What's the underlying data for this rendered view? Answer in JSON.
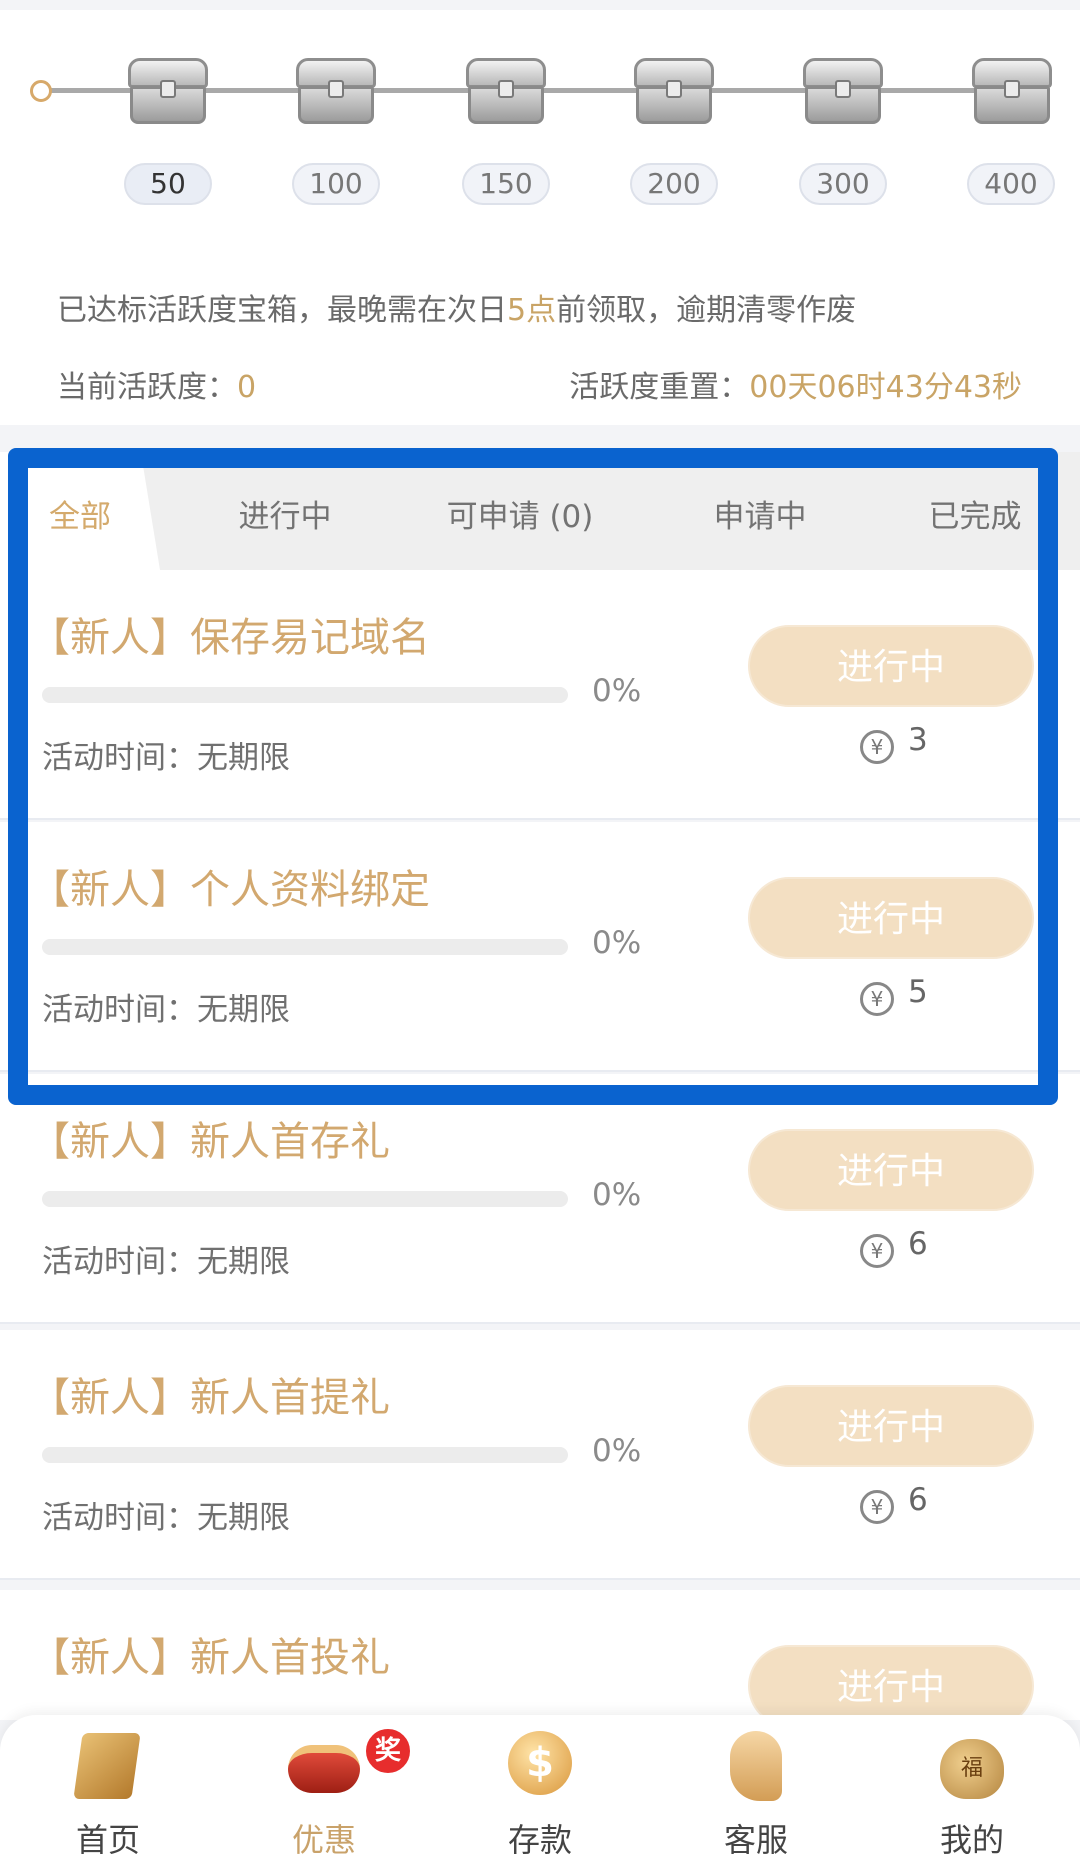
{
  "milestones": [
    "50",
    "100",
    "150",
    "200",
    "300",
    "400"
  ],
  "notice": {
    "prefix": "已达标活跃度宝箱，最晚需在次日",
    "highlight": "5点",
    "suffix": "前领取，逾期清零作废"
  },
  "activity": {
    "current_label": "当前活跃度：",
    "current_value": "0",
    "reset_label": "活跃度重置：",
    "reset_value": "00天06时43分43秒"
  },
  "tabs": [
    "全部",
    "进行中",
    "可申请 (0)",
    "申请中",
    "已完成"
  ],
  "tasks": [
    {
      "title": "【新人】保存易记域名",
      "progress": "0%",
      "time": "活动时间：无期限",
      "status": "进行中",
      "reward": "3"
    },
    {
      "title": "【新人】个人资料绑定",
      "progress": "0%",
      "time": "活动时间：无期限",
      "status": "进行中",
      "reward": "5"
    },
    {
      "title": "【新人】新人首存礼",
      "progress": "0%",
      "time": "活动时间：无期限",
      "status": "进行中",
      "reward": "6"
    },
    {
      "title": "【新人】新人首提礼",
      "progress": "0%",
      "time": "活动时间：无期限",
      "status": "进行中",
      "reward": "6"
    },
    {
      "title": "【新人】新人首投礼",
      "status": "进行中"
    }
  ],
  "nav": [
    "首页",
    "优惠",
    "存款",
    "客服",
    "我的"
  ],
  "nav_badge": "奖",
  "icons": {
    "coin": "yen-coin-icon",
    "chest": "treasure-chest-icon"
  },
  "colors": {
    "gold": "#c9a466",
    "highlight_border": "#0a63cf",
    "badge": "#e72d2d"
  }
}
